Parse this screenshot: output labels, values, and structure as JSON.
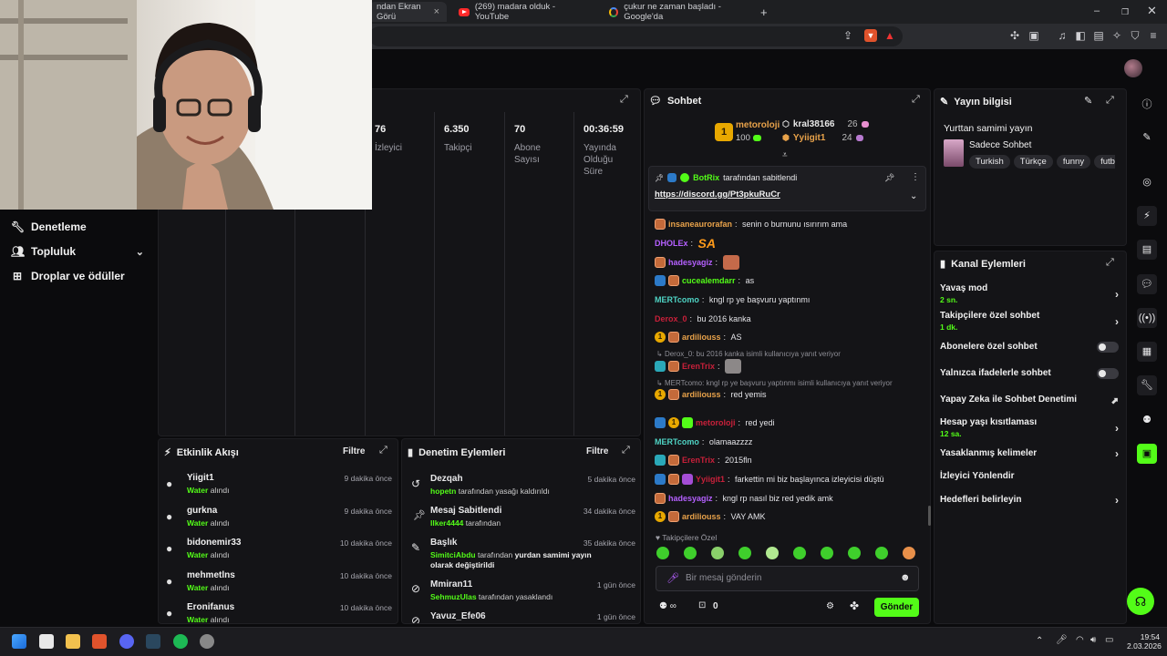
{
  "browser": {
    "tabs": [
      {
        "label": "ndan Ekran Görü",
        "active": true
      },
      {
        "label": "(269) madara olduk - YouTube",
        "active": false
      },
      {
        "label": "çukur ne zaman başladı - Google'da",
        "active": false
      }
    ],
    "new_tab": "+",
    "close": "×"
  },
  "nav": {
    "items": [
      {
        "label": "Denetleme",
        "icon": "wrench-icon"
      },
      {
        "label": "Topluluk",
        "icon": "users-icon"
      },
      {
        "label": "Droplar ve ödüller",
        "icon": "gift-icon"
      }
    ]
  },
  "stats": [
    {
      "value": "76",
      "label": "İzleyici"
    },
    {
      "value": "6.350",
      "label": "Takipçi"
    },
    {
      "value": "70",
      "label": "Abone Sayısı"
    },
    {
      "value": "00:36:59",
      "label": "Yayında Olduğu Süre"
    }
  ],
  "activity": {
    "title": "Etkinlik Akışı",
    "filter": "Filtre",
    "items": [
      {
        "name": "Yiigit1",
        "item": "Water",
        "suffix": "alındı",
        "time": "9 dakika önce"
      },
      {
        "name": "gurkna",
        "item": "Water",
        "suffix": "alındı",
        "time": "9 dakika önce"
      },
      {
        "name": "bidonemir33",
        "item": "Water",
        "suffix": "alındı",
        "time": "10 dakika önce"
      },
      {
        "name": "mehmetlns",
        "item": "Water",
        "suffix": "alındı",
        "time": "10 dakika önce"
      },
      {
        "name": "Eronifanus",
        "item": "Water",
        "suffix": "alındı",
        "time": "10 dakika önce"
      }
    ]
  },
  "moderation": {
    "title": "Denetim Eylemleri",
    "filter": "Filtre",
    "items": [
      {
        "title": "Dezqah",
        "actor": "hopetn",
        "text": "tarafından yasağı kaldırıldı",
        "extra": "",
        "time": "5 dakika önce",
        "icon": "undo-icon"
      },
      {
        "title": "Mesaj Sabitlendi",
        "actor": "Ilker4444",
        "text": "tarafından",
        "extra": "",
        "time": "34 dakika önce",
        "icon": "pin-icon"
      },
      {
        "title": "Başlık",
        "actor": "SimitciAbdu",
        "text": "tarafından",
        "extra": "yurdan samimi yayın olarak değiştirildi",
        "time": "35 dakika önce",
        "icon": "edit-icon"
      },
      {
        "title": "Mmiran11",
        "actor": "SehmuzUlas",
        "text": "tarafından yasaklandı",
        "extra": "",
        "time": "1 gün önce",
        "icon": "ban-icon"
      },
      {
        "title": "Yavuz_Efe06",
        "actor": "",
        "text": "",
        "extra": "",
        "time": "1 gün önce",
        "icon": "ban-icon"
      }
    ]
  },
  "chat": {
    "title": "Sohbet",
    "leaderboard": {
      "first": {
        "rank": "1",
        "name": "metoroloji",
        "points": "100"
      },
      "second": {
        "name": "kral38166",
        "points": "26"
      },
      "third": {
        "name": "Yyiigit1",
        "points": "24"
      }
    },
    "pinned": {
      "by": "BotRix",
      "by_suffix": "tarafından sabitlendi",
      "link": "https://discord.gg/Pt3pkuRuCr"
    },
    "messages": [
      {
        "user": "insaneaurorafan",
        "color": "#e8a24a",
        "text": "senin o burnunu ısırırım ama"
      },
      {
        "user": "DHOLEx",
        "color": "#b560ff",
        "text": ""
      },
      {
        "user": "hadesyagiz",
        "color": "#b560ff",
        "text": ""
      },
      {
        "user": "cucealemdarr",
        "color": "#53fc18",
        "text": "as"
      },
      {
        "user": "MERTcomo",
        "color": "#4fd3c4",
        "text": "kngl rp ye başvuru yaptınmı"
      },
      {
        "user": "Derox_0",
        "color": "#c8203a",
        "text": "bu 2016 kanka"
      },
      {
        "user": "ardiliouss",
        "color": "#e8a24a",
        "text": "AS"
      },
      {
        "reply": "Derox_0: bu 2016 kanka isimli kullanıcıya yanıt veriyor"
      },
      {
        "user": "ErenTrix",
        "color": "#c8203a",
        "text": ""
      },
      {
        "reply": "MERTcomo: kngl rp ye başvuru yaptınmı isimli kullanıcıya yanıt veriyor"
      },
      {
        "user": "ardiliouss",
        "color": "#e8a24a",
        "text": "red yemis"
      },
      {
        "user": "metoroloji",
        "color": "#c8203a",
        "text": "red yedi"
      },
      {
        "user": "MERTcomo",
        "color": "#4fd3c4",
        "text": "olamaazzzz"
      },
      {
        "user": "ErenTrix",
        "color": "#c8203a",
        "text": "2015fln"
      },
      {
        "user": "Yyiigit1",
        "color": "#c8203a",
        "text": "farkettin mi biz başlayınca izleyicisi düştü"
      },
      {
        "user": "hadesyagiz",
        "color": "#b560ff",
        "text": "kngl rp nasıl biz red yedik amk"
      },
      {
        "user": "ardiliouss",
        "color": "#e8a24a",
        "text": "VAY AMK"
      }
    ],
    "emote_strip_label": "Takipçilere Özel",
    "input_placeholder": "Bir mesaj gönderin",
    "points": "0",
    "send": "Gönder"
  },
  "stream_info": {
    "title": "Yayın bilgisi",
    "stream_title": "Yurttan samimi yayın",
    "category": "Sadece Sohbet",
    "tags": [
      "Turkish",
      "Türkçe",
      "funny",
      "futb"
    ]
  },
  "channel_actions": {
    "title": "Kanal Eylemleri",
    "items": [
      {
        "label": "Yavaş mod",
        "sub": "2 sn.",
        "control": "arrow"
      },
      {
        "label": "Takipçilere özel sohbet",
        "sub": "1 dk.",
        "control": "arrow"
      },
      {
        "label": "Abonelere özel sohbet",
        "sub": "",
        "control": "toggle"
      },
      {
        "label": "Yalnızca ifadelerle sohbet",
        "sub": "",
        "control": "toggle"
      },
      {
        "label": "Yapay Zeka ile Sohbet Denetimi",
        "sub": "",
        "control": "external"
      },
      {
        "label": "Hesap yaşı kısıtlaması",
        "sub": "12 sa.",
        "control": "arrow"
      },
      {
        "label": "Yasaklanmış kelimeler",
        "sub": "",
        "control": "arrow"
      },
      {
        "label": "İzleyici Yönlendir",
        "sub": "",
        "control": "none"
      },
      {
        "label": "Hedefleri belirleyin",
        "sub": "",
        "control": "arrow"
      }
    ]
  },
  "taskbar": {
    "time": "19:54",
    "date": "2.03.2026"
  },
  "colors": {
    "accent": "#53fc18",
    "panel": "#141417",
    "bg": "#0b0b0d"
  }
}
